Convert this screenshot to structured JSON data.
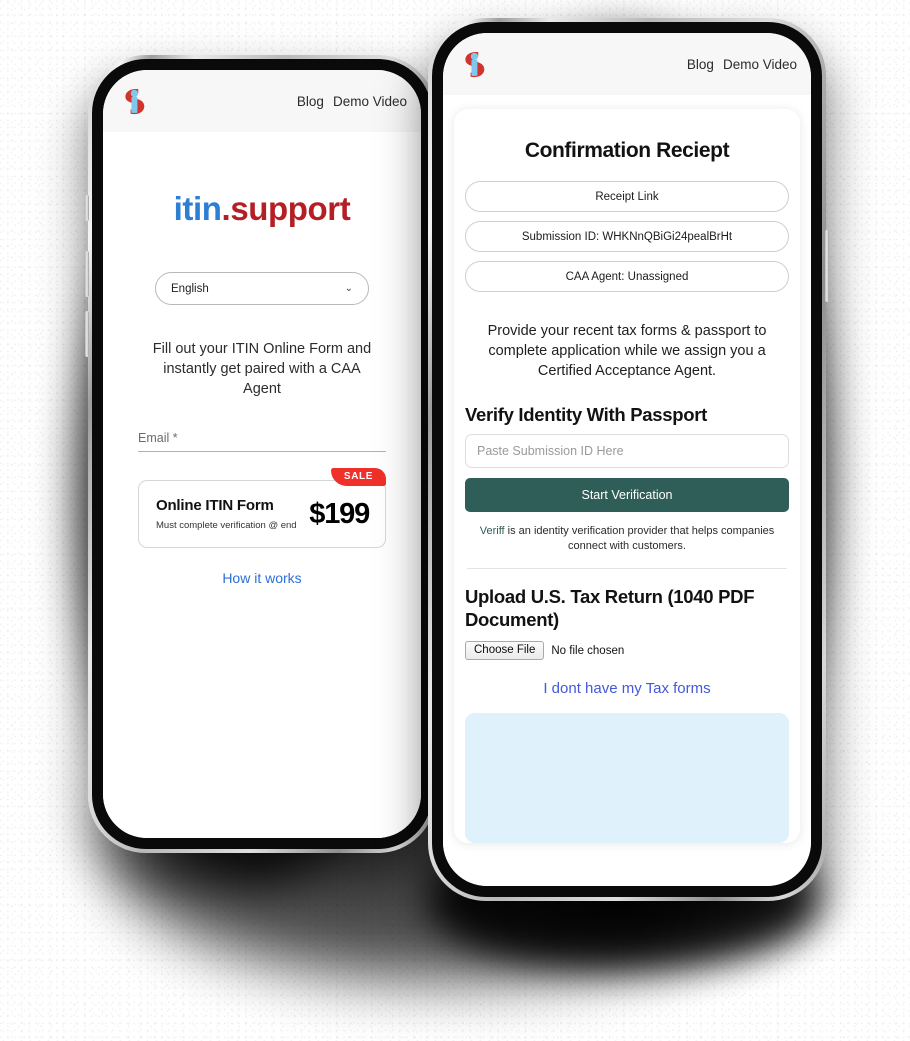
{
  "nav": {
    "logo_alt": "itin support logo",
    "links": [
      "Blog",
      "Demo Video"
    ]
  },
  "back_phone": {
    "brand": {
      "part1": "itin",
      "part2": ".support"
    },
    "language_select": {
      "value": "English",
      "chevron": "⌄"
    },
    "tagline": "Fill out your ITIN Online Form and instantly get paired with a CAA Agent",
    "email_label": "Email *",
    "price_card": {
      "badge": "SALE",
      "title": "Online ITIN Form",
      "subtitle": "Must complete verification @ end",
      "price": "$199"
    },
    "how_it_works": "How it works"
  },
  "front_phone": {
    "title": "Confirmation Reciept",
    "pills": [
      "Receipt Link",
      "Submission ID: WHKNnQBiGi24pealBrHt",
      "CAA Agent: Unassigned"
    ],
    "blurb": "Provide your recent tax forms & passport to complete application while we assign you a Certified Acceptance Agent.",
    "verify_heading": "Verify Identity With Passport",
    "submission_input_placeholder": "Paste Submission ID Here",
    "start_verification_label": "Start Verification",
    "veriff_note": {
      "link": "Veriff",
      "rest": " is an identity verification provider that helps companies connect with customers."
    },
    "upload_heading": "Upload U.S. Tax Return (1040 PDF Document)",
    "file_button_label": "Choose File",
    "file_status": "No file chosen",
    "no_tax_forms_link": "I dont have my Tax forms"
  },
  "colors": {
    "brand_blue": "#2e7fd4",
    "brand_red": "#b31f24",
    "cta_teal": "#2f5e58",
    "sale_red": "#f0302a",
    "link_blue": "#4359d8",
    "panel_blue": "#dff1fa"
  }
}
